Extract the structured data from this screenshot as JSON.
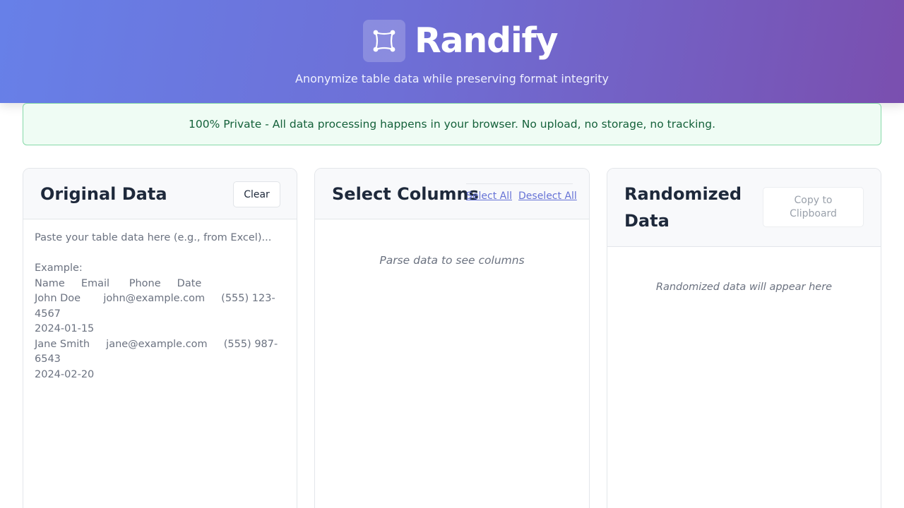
{
  "app": {
    "title": "Randify",
    "tagline": "Anonymize table data while preserving format integrity",
    "logo_icon": "vector-square-icon"
  },
  "privacy_banner": {
    "text": "100% Private - All data processing happens in your browser. No upload, no storage, no tracking."
  },
  "original_panel": {
    "title": "Original Data",
    "clear_label": "Clear",
    "placeholder_lines": [
      "Paste your table data here (e.g., from Excel)...",
      "",
      "Example:",
      "Name     Email      Phone     Date",
      "John Doe       john@example.com     (555) 123-4567",
      "2024-01-15",
      "Jane Smith     jane@example.com     (555) 987-6543",
      "2024-02-20"
    ]
  },
  "columns_panel": {
    "title": "Select Columns",
    "select_all_label": "Select All",
    "deselect_all_label": "Deselect All",
    "empty_text": "Parse data to see columns"
  },
  "randomized_panel": {
    "title": "Randomized Data",
    "copy_label": "Copy to Clipboard",
    "empty_text": "Randomized data will appear here"
  },
  "colors": {
    "header_gradient_start": "#6780e8",
    "header_gradient_end": "#7a4faf",
    "banner_bg": "#effcf4",
    "banner_border": "#86d9a8",
    "banner_text": "#14613a",
    "link": "#6673d6"
  }
}
